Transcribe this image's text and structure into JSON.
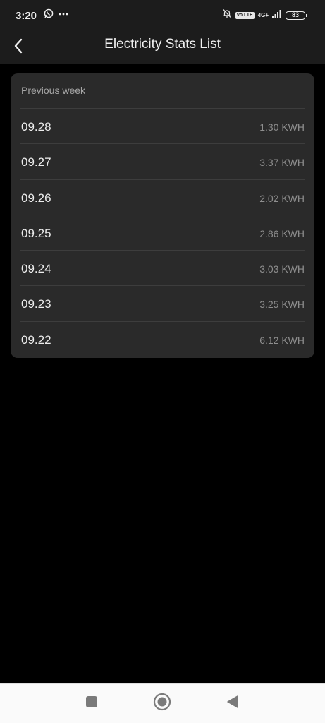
{
  "status_bar": {
    "time": "3:20",
    "network_badge": "Vo LTE",
    "network_type": "4G+",
    "battery": "83"
  },
  "header": {
    "title": "Electricity Stats List"
  },
  "card": {
    "section_title": "Previous week",
    "rows": [
      {
        "date": "09.28",
        "value": "1.30 KWH"
      },
      {
        "date": "09.27",
        "value": "3.37 KWH"
      },
      {
        "date": "09.26",
        "value": "2.02 KWH"
      },
      {
        "date": "09.25",
        "value": "2.86 KWH"
      },
      {
        "date": "09.24",
        "value": "3.03 KWH"
      },
      {
        "date": "09.23",
        "value": "3.25 KWH"
      },
      {
        "date": "09.22",
        "value": "6.12 KWH"
      }
    ]
  },
  "nav_bar": {
    "icons": [
      "recent-apps-icon",
      "home-icon",
      "back-icon"
    ]
  },
  "colors": {
    "background": "#000000",
    "bar": "#1c1c1c",
    "card": "#2a2a2a",
    "divider": "#3d3d3d",
    "muted_text": "#8e8e8e"
  }
}
